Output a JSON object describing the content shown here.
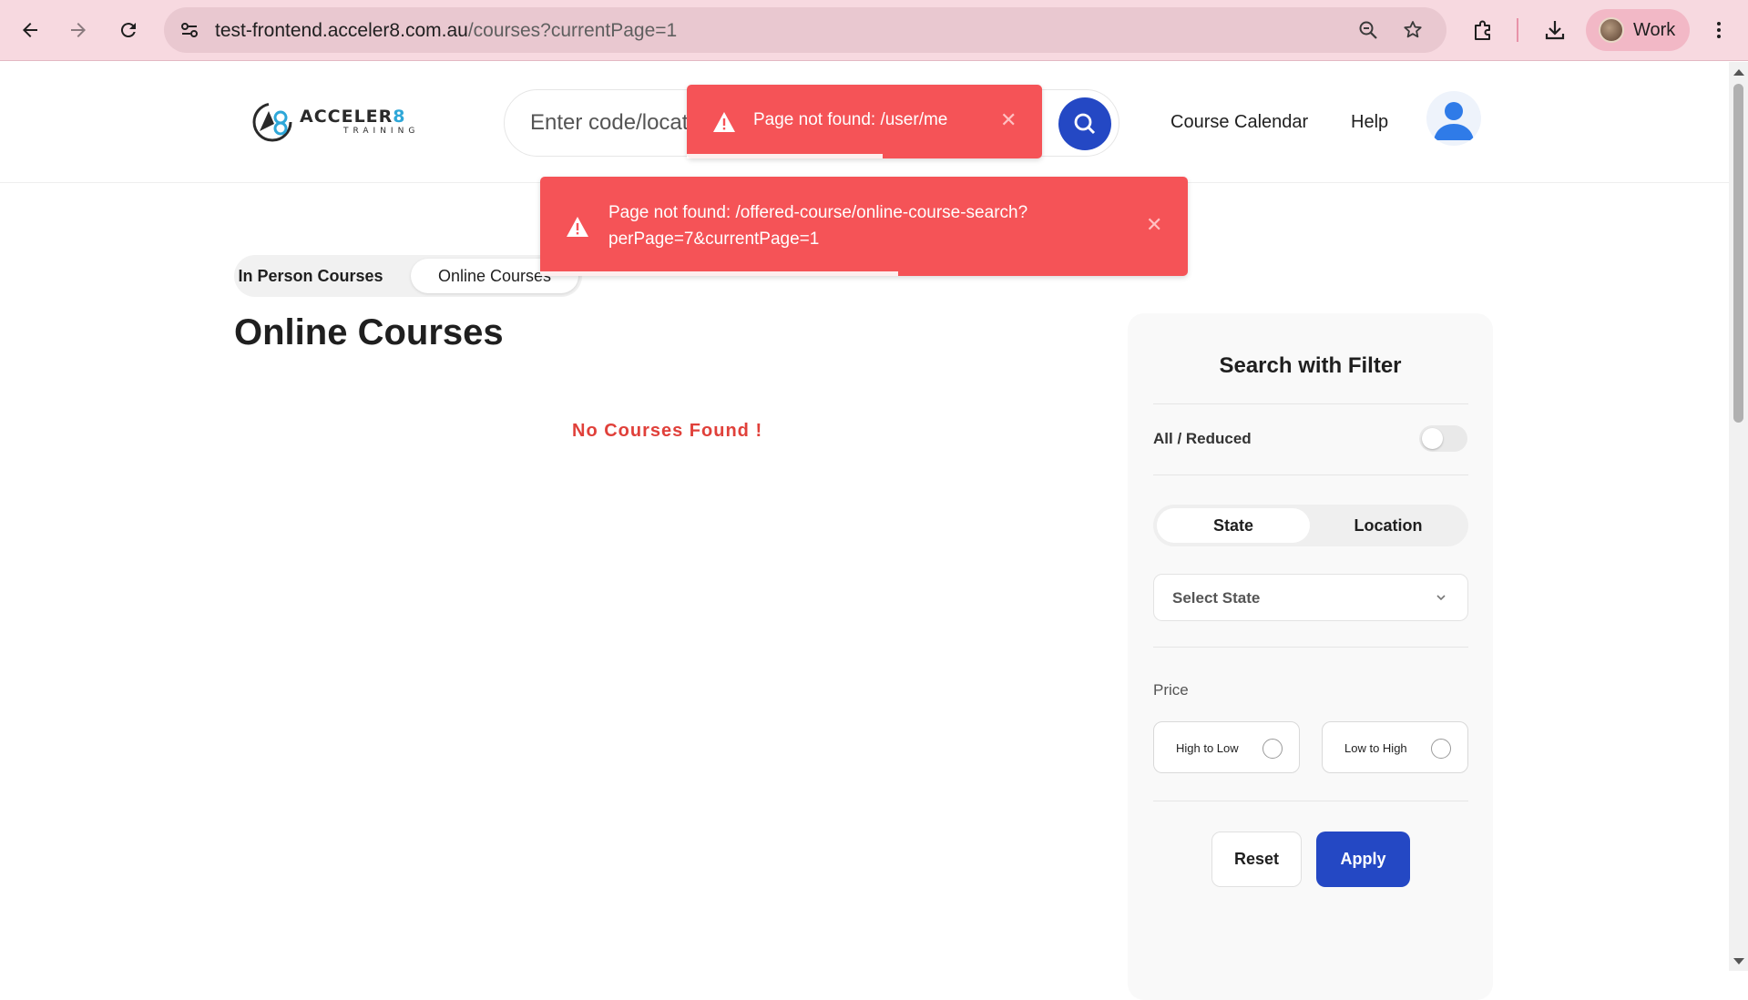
{
  "browser": {
    "url_host": "test-frontend.acceler8.com.au",
    "url_path": "/courses?currentPage=1",
    "profile_label": "Work"
  },
  "header": {
    "logo_word": "ACCELER",
    "logo_digit": "8",
    "logo_sub": "TRAINING",
    "search_placeholder": "Enter code/location",
    "nav": [
      "Course Calendar",
      "Help"
    ]
  },
  "toasts": [
    {
      "icon": "warning-icon",
      "message": "Page not found: /user/me",
      "progress": 0.55
    },
    {
      "icon": "warning-icon",
      "line1": "Page not found: /offered-course/online-course-search?",
      "line2": "perPage=7&currentPage=1",
      "progress": 0.55
    }
  ],
  "tabs": {
    "in_person": "In Person Courses",
    "online": "Online Courses",
    "active": "online"
  },
  "main": {
    "title": "Online Courses",
    "empty_message": "No Courses Found !"
  },
  "filter": {
    "title": "Search with Filter",
    "toggle_label": "All / Reduced",
    "toggle_on": false,
    "segments": [
      "State",
      "Location"
    ],
    "active_segment": "State",
    "select_placeholder": "Select State",
    "price_label": "Price",
    "price_options": [
      "High to Low",
      "Low to High"
    ],
    "reset_label": "Reset",
    "apply_label": "Apply"
  },
  "colors": {
    "brand_blue": "#2448c4",
    "toast_red": "#f55357",
    "error_text": "#e0403a",
    "chrome_pink": "#f7d9e0"
  }
}
